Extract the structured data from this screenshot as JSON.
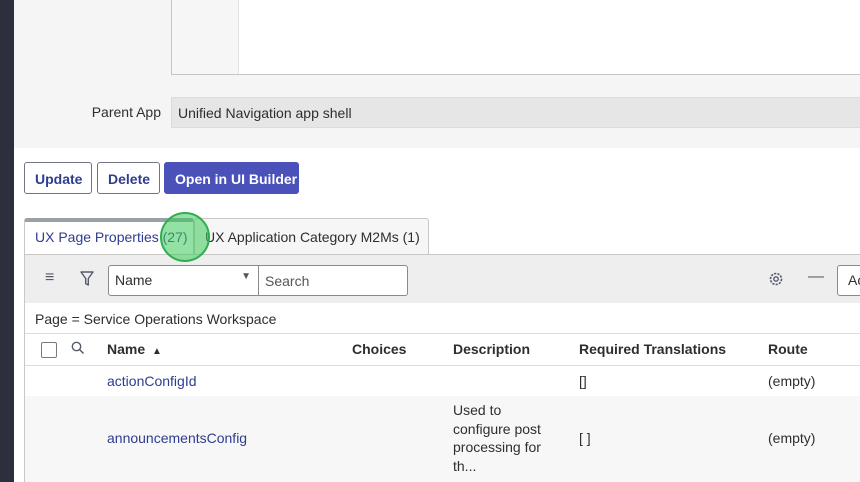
{
  "form": {
    "parent_app_label": "Parent App",
    "parent_app_value": "Unified Navigation app shell"
  },
  "actions": {
    "update_label": "Update",
    "delete_label": "Delete",
    "open_ui_builder_label": "Open in UI Builder"
  },
  "tabs": [
    {
      "label": "UX Page Properties (27)",
      "active": true
    },
    {
      "label": "UX Application Category M2Ms (1)",
      "active": false
    }
  ],
  "list": {
    "filter_field": "Name",
    "search_placeholder": "Search",
    "action_prefix": "Ac",
    "breadcrumb": "Page = Service Operations Workspace",
    "columns": [
      {
        "label": "Name",
        "sort": "ascending"
      },
      {
        "label": "Choices"
      },
      {
        "label": "Description"
      },
      {
        "label": "Required Translations"
      },
      {
        "label": "Route"
      }
    ],
    "rows": [
      {
        "name": "actionConfigId",
        "choices": "",
        "description": "",
        "required_translations": "[]",
        "route": "(empty)"
      },
      {
        "name": "announcementsConfig",
        "choices": "",
        "description": "Used to configure post processing for th...",
        "required_translations": "[ ]",
        "route": "(empty)"
      }
    ]
  },
  "icons": {
    "list_menu": "hamburger-menu-icon",
    "filter": "funnel-filter-icon",
    "column_search": "magnifier-icon",
    "settings": "gear-icon",
    "collapse": "minus-icon",
    "sort": "sort-ascending-icon",
    "dropdown": "caret-down-icon"
  },
  "colors": {
    "primary_button": "#4a51b8",
    "link": "#2e3d8e",
    "nav_strip": "#2d2f3f",
    "click_marker": "#3cc85a"
  }
}
